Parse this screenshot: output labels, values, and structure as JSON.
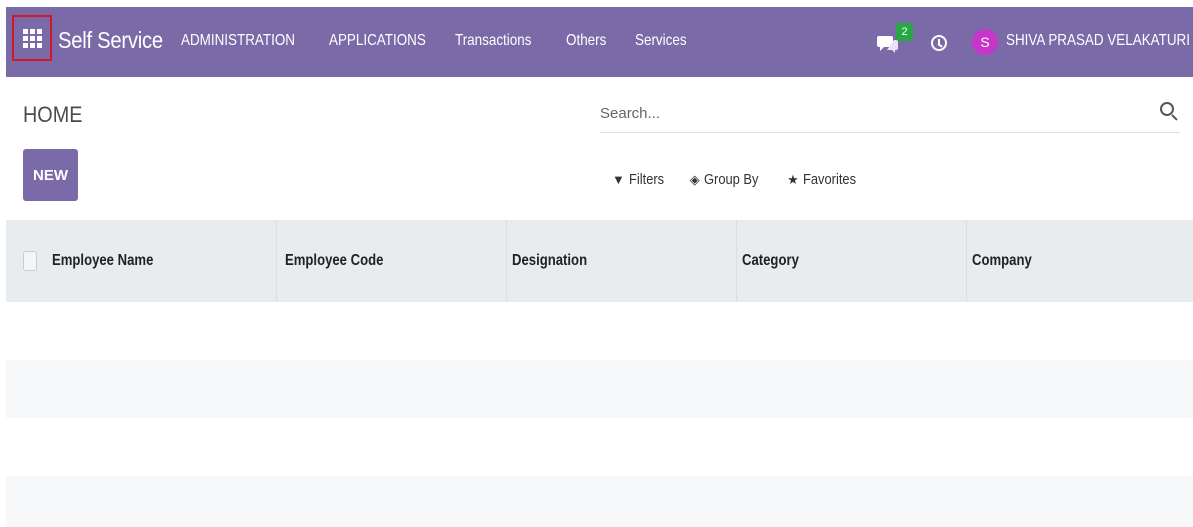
{
  "navbar": {
    "brand": "Self Service",
    "menu": [
      "ADMINISTRATION",
      "APPLICATIONS",
      "Transactions",
      "Others",
      "Services"
    ],
    "messages_badge": "2",
    "user_initial": "S",
    "user_name": "SHIVA PRASAD VELAKATURI",
    "colors": {
      "navbar": "#7b6aa8",
      "badge": "#28a745",
      "avatar": "#c735c9"
    }
  },
  "control_panel": {
    "title": "HOME",
    "new_label": "NEW",
    "search_placeholder": "Search...",
    "filters_label": "Filters",
    "group_by_label": "Group By",
    "favorites_label": "Favorites"
  },
  "table": {
    "columns": [
      "Employee Name",
      "Employee Code",
      "Designation",
      "Category",
      "Company"
    ],
    "rows": []
  }
}
